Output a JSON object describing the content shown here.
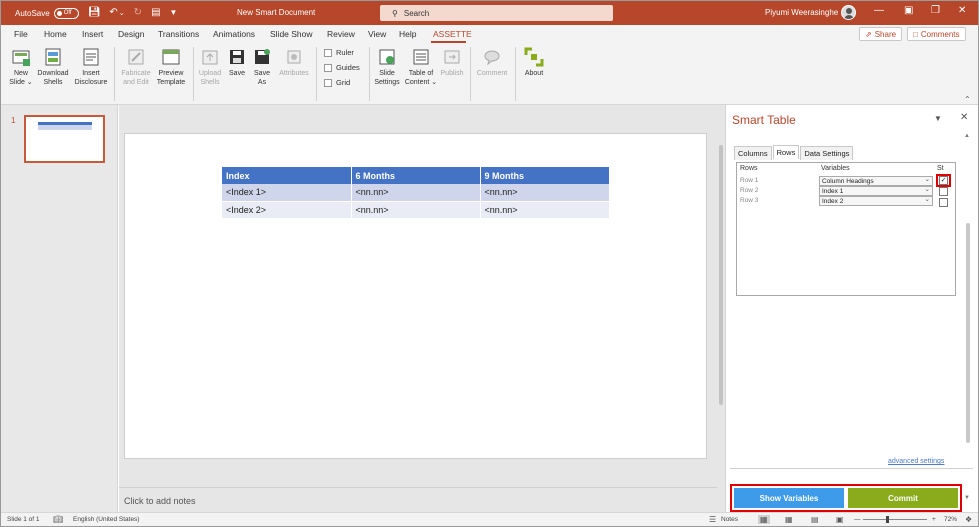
{
  "titlebar": {
    "autosave_label": "AutoSave",
    "autosave_state": "Off",
    "doc_title": "New Smart Document",
    "search_placeholder": "Search",
    "user_name": "Piyumi Weerasinghe",
    "icons": [
      "save-icon",
      "undo-icon",
      "redo-icon",
      "present-icon",
      "customize-icon",
      "minimize-icon",
      "restore-icon",
      "close-icon"
    ]
  },
  "menu": {
    "items": [
      "File",
      "Home",
      "Insert",
      "Design",
      "Transitions",
      "Animations",
      "Slide Show",
      "Review",
      "View",
      "Help",
      "ASSETTE"
    ],
    "active": "ASSETTE",
    "share_label": "Share",
    "comments_label": "Comments"
  },
  "ribbon": {
    "buttons": [
      {
        "l1": "New",
        "l2": "Slide ⌄",
        "enabled": true
      },
      {
        "l1": "Download",
        "l2": "Shells",
        "enabled": true
      },
      {
        "l1": "Insert",
        "l2": "Disclosure",
        "enabled": true
      },
      {
        "l1": "Fabricate",
        "l2": "and Edit",
        "enabled": false
      },
      {
        "l1": "Preview",
        "l2": "Template",
        "enabled": true
      },
      {
        "l1": "Upload",
        "l2": "Shells",
        "enabled": false
      },
      {
        "l1": "Save",
        "l2": "",
        "enabled": true
      },
      {
        "l1": "Save",
        "l2": "As",
        "enabled": true
      },
      {
        "l1": "Attributes",
        "l2": "",
        "enabled": false
      },
      {
        "l1": "Slide",
        "l2": "Settings",
        "enabled": true
      },
      {
        "l1": "Table of",
        "l2": "Content ⌄",
        "enabled": true
      },
      {
        "l1": "Publish",
        "l2": "",
        "enabled": false
      },
      {
        "l1": "Comment",
        "l2": "",
        "enabled": false
      },
      {
        "l1": "About",
        "l2": "",
        "enabled": true
      }
    ],
    "checkboxes": [
      "Ruler",
      "Guides",
      "Grid"
    ]
  },
  "thumbnails": {
    "slide_number": "1"
  },
  "slide": {
    "table": {
      "headers": [
        "Index",
        "6 Months",
        "9 Months"
      ],
      "rows": [
        [
          "<Index 1>",
          "<nn.nn>",
          "<nn.nn>"
        ],
        [
          "<Index 2>",
          "<nn.nn>",
          "<nn.nn>"
        ]
      ]
    }
  },
  "notes_placeholder": "Click to add notes",
  "taskpane": {
    "title": "Smart Table",
    "tabs": [
      "Columns",
      "Rows",
      "Data Settings"
    ],
    "active_tab": "Rows",
    "grid": {
      "headers": [
        "Rows",
        "Variables",
        "St"
      ],
      "rows": [
        {
          "name": "Row 1",
          "variable": "Column Headings",
          "checked": true
        },
        {
          "name": "Row 2",
          "variable": "Index 1",
          "checked": false
        },
        {
          "name": "Row 3",
          "variable": "Index 2",
          "checked": false
        }
      ]
    },
    "advanced_link": "advanced settings",
    "show_variables_label": "Show Variables",
    "commit_label": "Commit",
    "colors": {
      "show_variables": "#3d9be9",
      "commit": "#8aac1c",
      "highlight": "#e00000"
    }
  },
  "statusbar": {
    "slide_info": "Slide 1 of 1",
    "language": "English (United States)",
    "notes_label": "Notes",
    "zoom": "72%"
  },
  "colors": {
    "accent": "#b7472a",
    "table_header": "#4472c4"
  }
}
